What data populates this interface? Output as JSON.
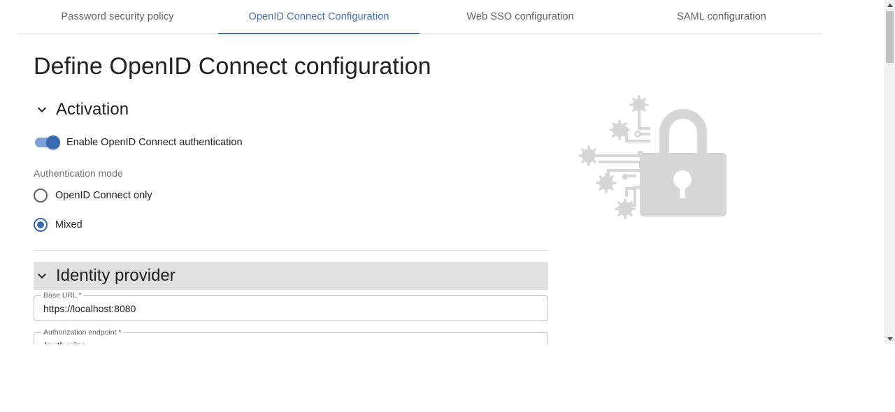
{
  "tabs": [
    {
      "label": "Password security policy",
      "active": false
    },
    {
      "label": "OpenID Connect Configuration",
      "active": true
    },
    {
      "label": "Web SSO configuration",
      "active": false
    },
    {
      "label": "SAML configuration",
      "active": false
    }
  ],
  "page_title": "Define OpenID Connect configuration",
  "activation": {
    "title": "Activation",
    "toggle_label": "Enable OpenID Connect authentication",
    "toggle_on": true,
    "auth_mode_label": "Authentication mode",
    "options": [
      {
        "label": "OpenID Connect only",
        "selected": false
      },
      {
        "label": "Mixed",
        "selected": true
      }
    ]
  },
  "identity_provider": {
    "title": "Identity provider",
    "base_url": {
      "label": "Base URL *",
      "value": "https://localhost:8080"
    },
    "authorization_endpoint": {
      "label": "Authorization endpoint *",
      "value": "/authorize"
    }
  },
  "colors": {
    "accent": "#3869b1",
    "tab_active": "#3f6fb6",
    "section_header_bg": "#e0e0e0",
    "illustration": "#d6d6d6"
  },
  "icons": {
    "section_toggle": "chevron-down-icon",
    "illustration": "lock-gears-illustration"
  }
}
